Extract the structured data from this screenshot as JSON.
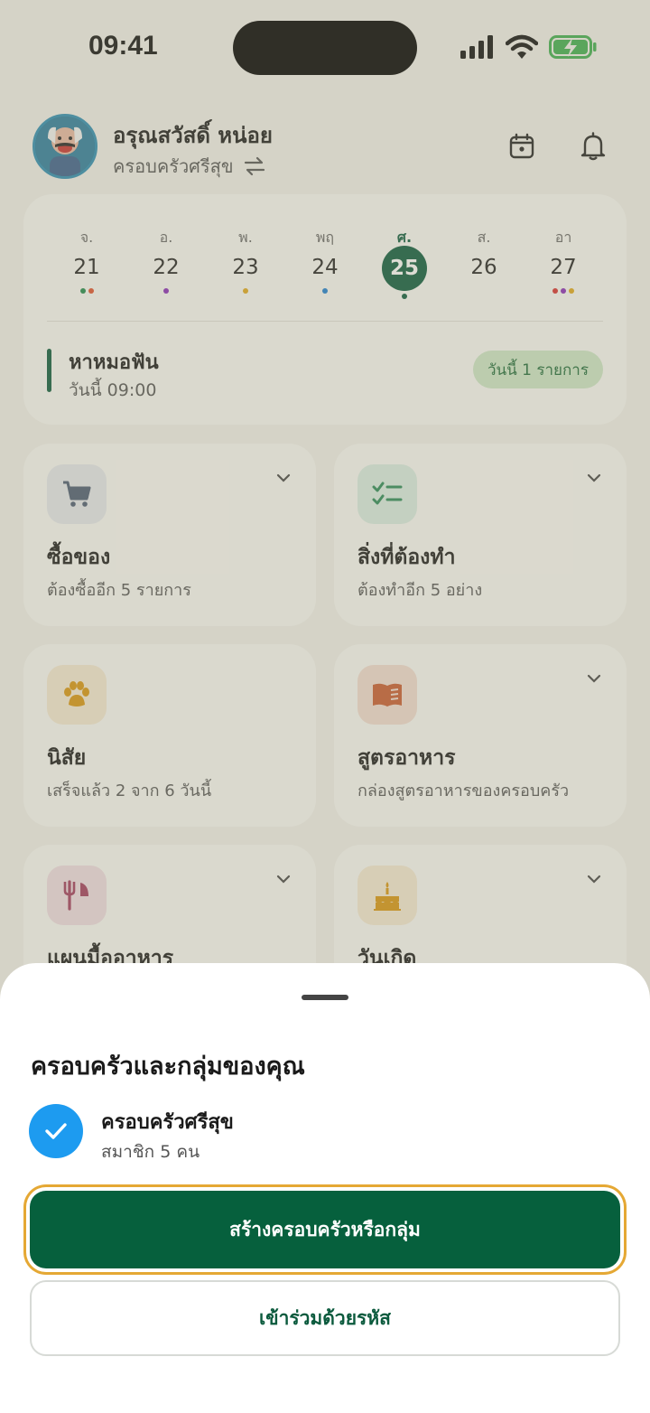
{
  "status_bar": {
    "time": "09:41"
  },
  "header": {
    "user_name": "อรุณสวัสดิ์ หน่อย",
    "family_name": "ครอบครัวศรีสุข",
    "icons": {
      "calendar": "calendar-icon",
      "bell": "bell-icon",
      "switch": "switch-icon"
    }
  },
  "calendar": {
    "days": [
      {
        "name": "จ.",
        "date": "21",
        "dots": [
          "#1f8a4c",
          "#e0522d"
        ]
      },
      {
        "name": "อ.",
        "date": "22",
        "dots": [
          "#8a2bb8"
        ]
      },
      {
        "name": "พ.",
        "date": "23",
        "dots": [
          "#e2a91b"
        ]
      },
      {
        "name": "พฤ",
        "date": "24",
        "dots": [
          "#1d7fd1"
        ]
      },
      {
        "name": "ศ.",
        "date": "25",
        "dots": [
          "#0b5a3d"
        ],
        "active": true
      },
      {
        "name": "ส.",
        "date": "26",
        "dots": []
      },
      {
        "name": "อา",
        "date": "27",
        "dots": [
          "#d8302e",
          "#8a2bb8",
          "#e2a91b"
        ]
      }
    ],
    "event": {
      "title": "หาหมอฟัน",
      "time": "วันนี้ 09:00",
      "badge": "วันนี้ 1 รายการ"
    }
  },
  "tiles": {
    "shopping": {
      "title": "ซื้อของ",
      "subtitle": "ต้องซื้ออีก 5 รายการ",
      "icon": "cart-icon"
    },
    "todo": {
      "title": "สิ่งที่ต้องทำ",
      "subtitle": "ต้องทำอีก 5 อย่าง",
      "icon": "checklist-icon"
    },
    "habits": {
      "title": "นิสัย",
      "subtitle": "เสร็จแล้ว 2 จาก 6 วันนี้",
      "icon": "paw-icon"
    },
    "recipes": {
      "title": "สูตรอาหาร",
      "subtitle": "กล่องสูตรอาหารของครอบครัว",
      "icon": "book-icon"
    },
    "meal_plan": {
      "title": "แผนมื้ออาหาร",
      "icon": "utensils-icon"
    },
    "birthday": {
      "title": "วันเกิด",
      "icon": "cake-icon"
    }
  },
  "sheet": {
    "title": "ครอบครัวและกลุ่มของคุณ",
    "family": {
      "name": "ครอบครัวศรีสุข",
      "members": "สมาชิก 5 คน",
      "selected": true
    },
    "create_button": "สร้างครอบครัวหรือกลุ่ม",
    "join_button": "เข้าร่วมด้วยรหัส"
  },
  "colors": {
    "primary": "#06603d",
    "focus_ring": "#e5a834",
    "check": "#1d9bf0",
    "badge_bg": "#cfe7c8"
  }
}
